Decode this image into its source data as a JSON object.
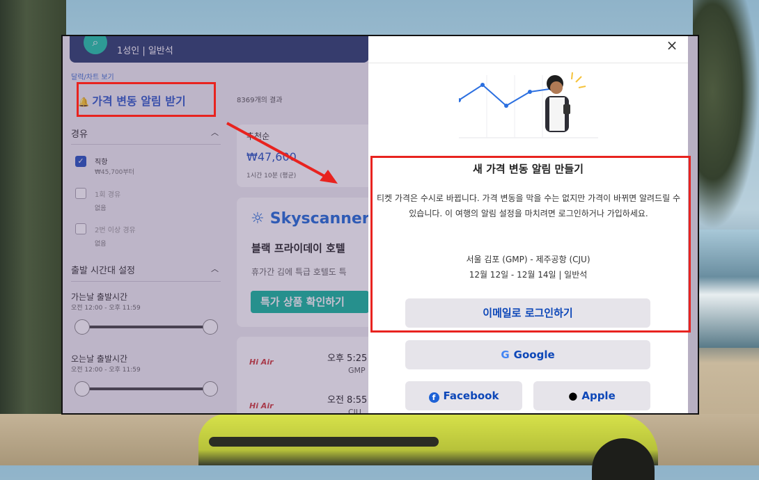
{
  "search": {
    "icon": "search-icon",
    "subtitle": "1성인 | 일반석"
  },
  "left": {
    "calendar_link": "달력/차트 보기",
    "price_alert_button": "가격 변동 알림 받기",
    "result_count": "8369개의 결과",
    "stops_title": "경유",
    "stops": [
      {
        "label": "직항",
        "sub": "₩45,700부터",
        "checked": true
      },
      {
        "label": "1회 경유",
        "sub": "없음",
        "checked": false
      },
      {
        "label": "2번 이상 경유",
        "sub": "없음",
        "checked": false
      }
    ],
    "departure_time_title": "출발 시간대 설정",
    "outbound_label": "가는날 출발시간",
    "outbound_range": "오전 12:00 - 오후 11:59",
    "return_label": "오는날 출발시간",
    "return_range": "오전 12:00 - 오후 11:59"
  },
  "results": {
    "sort_label": "추천순",
    "price": "₩47,600",
    "price_sub": "1시간 10분 (평균)",
    "promo_brand": "Skyscanner",
    "promo_title": "블랙 프라이데이 호텔",
    "promo_sub": "휴가간 김에 특급 호텔도 특",
    "promo_button": "특가 상품 확인하기",
    "flights": [
      {
        "airline": "Hi Air",
        "time": "오후 5:25",
        "code": "GMP"
      },
      {
        "airline": "Hi Air",
        "time": "오전 8:55",
        "code": "CJU"
      }
    ]
  },
  "modal": {
    "close": "×",
    "title": "새 가격 변동 알림 만들기",
    "description": "티켓 가격은 수시로 바뀝니다. 가격 변동을 막을 수는 없지만 가격이 바뀌면 알려드릴 수 있습니다. 이 여행의 알림 설정을 마치려면 로그인하거나 가입하세요.",
    "route": "서울 김포 (GMP) - 제주공항 (CJU)",
    "dates": "12월 12일 - 12월 14일 | 일반석",
    "email_button": "이메일로 로그인하기",
    "google_button": "Google",
    "facebook_button": "Facebook",
    "apple_button": "Apple"
  },
  "colors": {
    "accent": "#2451c0",
    "annotation": "#e8231f",
    "button_bg": "#e6e4ea"
  }
}
